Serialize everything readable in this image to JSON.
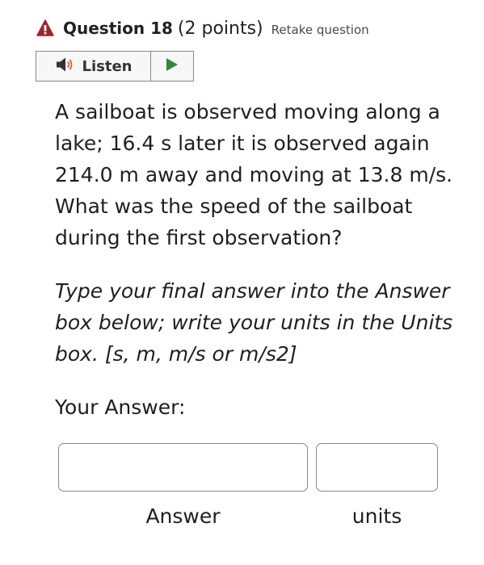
{
  "header": {
    "question_title": "Question 18",
    "points": "(2 points)",
    "retake_link": "Retake question",
    "warning_color": "#a4232a"
  },
  "listen": {
    "label": "Listen",
    "play_color": "#2e8b3a"
  },
  "question": {
    "text": "A sailboat is observed moving along a lake; 16.4 s later it is observed again 214.0 m away and moving at 13.8 m/s. What was the speed of the sailboat during the first observation?",
    "instructions": "Type your final answer into the Answer box below; write your units in the Units box. [s, m, m/s or m/s2]"
  },
  "answer_section": {
    "heading": "Your Answer:",
    "answer_value": "",
    "answer_label": "Answer",
    "units_value": "",
    "units_label": "units"
  }
}
